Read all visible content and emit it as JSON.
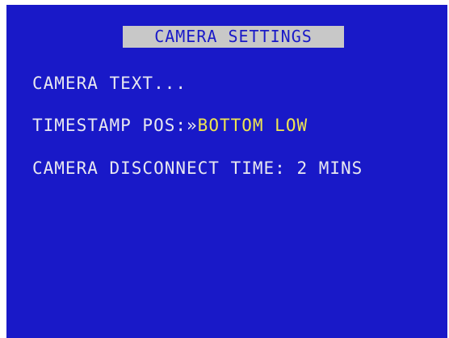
{
  "menu": {
    "title": "CAMERA SETTINGS",
    "items": [
      {
        "label": "CAMERA TEXT..."
      },
      {
        "label": "TIMESTAMP POS:",
        "cursor": "»",
        "value": "BOTTOM LOW"
      },
      {
        "label": "CAMERA DISCONNECT TIME:",
        "value": "2 MINS"
      }
    ]
  },
  "colors": {
    "background": "#1919c8",
    "text": "#e8e8f0",
    "highlight": "#f0e650",
    "title_bar": "#c8c8c8"
  }
}
